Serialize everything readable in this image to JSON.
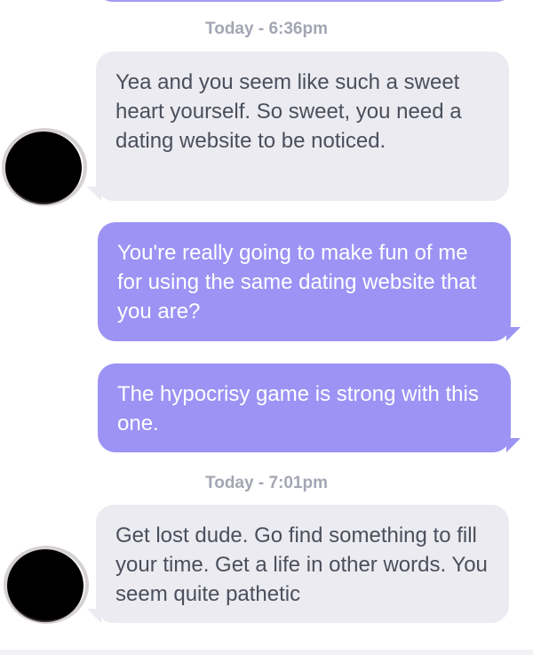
{
  "colors": {
    "incoming_bubble": "#ebebf1",
    "outgoing_bubble": "#9c93f4",
    "timestamp_text": "#a3a6b3"
  },
  "conversation": {
    "timestamps": [
      "Today - 6:36pm",
      "Today - 7:01pm"
    ],
    "messages": [
      {
        "direction": "incoming",
        "text": "Yea and you seem like such a sweet heart yourself. So sweet, you need a dating website to be noticed."
      },
      {
        "direction": "outgoing",
        "text": "You're really going to make fun of me for using the same dating website that you are?"
      },
      {
        "direction": "outgoing",
        "text": "The hypocrisy game is strong with this one."
      },
      {
        "direction": "incoming",
        "text": "Get lost dude. Go find something to fill your time. Get a life in other words. You seem quite pathetic"
      }
    ]
  },
  "icons": {
    "avatar": "contact-avatar-redacted"
  }
}
